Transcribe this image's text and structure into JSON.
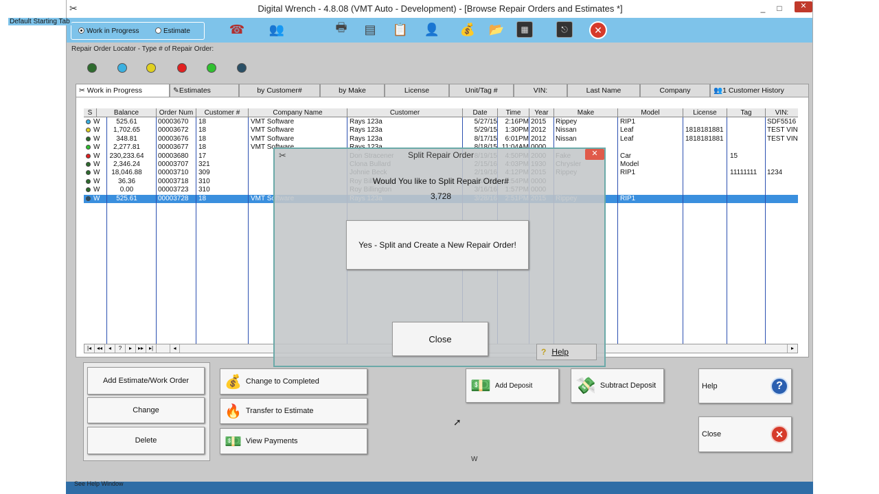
{
  "window": {
    "title": "Digital Wrench - 4.8.08 (VMT Auto - Development) - [Browse Repair Orders and Estimates *]",
    "minimize": "_",
    "maximize": "□",
    "close": "✕"
  },
  "toolbar": {
    "default_tab_legend": "Default Starting Tab",
    "radio_wip": "Work in Progress",
    "radio_estimate": "Estimate",
    "selected": "Work in Progress",
    "icons": [
      "phone-icon",
      "people-icon",
      "printer-icon",
      "report-icon",
      "document-icon",
      "technician-icon",
      "money-icon",
      "folder-icon",
      "monitor-icon",
      "logout-icon",
      "stop-icon"
    ]
  },
  "locator": {
    "label": "Repair Order Locator - Type # of Repair Order:",
    "status_colors": [
      "#2e6b2e",
      "#3ab0e0",
      "#e0d020",
      "#e02020",
      "#30c030",
      "#2a4f66"
    ]
  },
  "tabs": [
    "Work in Progress",
    "Estimates",
    "by Customer#",
    "by Make",
    "License",
    "Unit/Tag #",
    "VIN:",
    "Last Name",
    "Company",
    "1 Customer History"
  ],
  "grid": {
    "columns": [
      "S",
      "Balance",
      "Order Num",
      "Customer #",
      "Company Name",
      "Customer",
      "Date",
      "Time",
      "Year",
      "Make",
      "Model",
      "License",
      "Tag",
      "VIN:"
    ],
    "rows": [
      {
        "color": "#3ab0e0",
        "s": "W",
        "balance": "525.61",
        "order": "00003670",
        "cust": "18",
        "company": "VMT Software",
        "customer": "Rays 123a",
        "date": "5/27/15",
        "time": "2:16PM",
        "year": "2015",
        "make": "Rippey",
        "model": "RIP1",
        "license": "",
        "tag": "",
        "vin": "SDF5516"
      },
      {
        "color": "#e0d020",
        "s": "W",
        "balance": "1,702.65",
        "order": "00003672",
        "cust": "18",
        "company": "VMT Software",
        "customer": "Rays 123a",
        "date": "5/29/15",
        "time": "1:30PM",
        "year": "2012",
        "make": "Nissan",
        "model": "Leaf",
        "license": "1818181881",
        "tag": "",
        "vin": "TEST VIN"
      },
      {
        "color": "#2e6b2e",
        "s": "W",
        "balance": "348.81",
        "order": "00003676",
        "cust": "18",
        "company": "VMT Software",
        "customer": "Rays 123a",
        "date": "8/17/15",
        "time": "6:01PM",
        "year": "2012",
        "make": "Nissan",
        "model": "Leaf",
        "license": "1818181881",
        "tag": "",
        "vin": "TEST VIN"
      },
      {
        "color": "#30c030",
        "s": "W",
        "balance": "2,277.81",
        "order": "00003677",
        "cust": "18",
        "company": "VMT Software",
        "customer": "Rays 123a",
        "date": "8/18/15",
        "time": "11:04AM",
        "year": "0000",
        "make": "",
        "model": "",
        "license": "",
        "tag": "",
        "vin": ""
      },
      {
        "color": "#e02020",
        "s": "W",
        "balance": "230,233.64",
        "order": "00003680",
        "cust": "17",
        "company": "",
        "customer": "Don Stracener",
        "date": "8/19/15",
        "time": "4:50PM",
        "year": "2000",
        "make": "Fake",
        "model": "Car",
        "license": "",
        "tag": "15",
        "vin": ""
      },
      {
        "color": "#2e6b2e",
        "s": "W",
        "balance": "2,346.24",
        "order": "00003707",
        "cust": "321",
        "company": "",
        "customer": "Clona Bullard",
        "date": "2/15/16",
        "time": "4:03PM",
        "year": "1930",
        "make": "Chrysler",
        "model": "Model",
        "license": "",
        "tag": "",
        "vin": ""
      },
      {
        "color": "#2e6b2e",
        "s": "W",
        "balance": "18,046.88",
        "order": "00003710",
        "cust": "309",
        "company": "",
        "customer": "Johnie Beck",
        "date": "2/19/16",
        "time": "4:12PM",
        "year": "2015",
        "make": "Rippey",
        "model": "RIP1",
        "license": "",
        "tag": "11111111",
        "vin": "1234"
      },
      {
        "color": "#2e6b2e",
        "s": "W",
        "balance": "36.36",
        "order": "00003718",
        "cust": "310",
        "company": "",
        "customer": "Roy Billington",
        "date": "3/1/16",
        "time": "2:54PM",
        "year": "0000",
        "make": "",
        "model": "",
        "license": "",
        "tag": "",
        "vin": ""
      },
      {
        "color": "#2e6b2e",
        "s": "W",
        "balance": "0.00",
        "order": "00003723",
        "cust": "310",
        "company": "",
        "customer": "Roy Billington",
        "date": "3/16/16",
        "time": "1:57PM",
        "year": "0000",
        "make": "",
        "model": "",
        "license": "",
        "tag": "",
        "vin": ""
      },
      {
        "color": "#2a4f66",
        "s": "W",
        "balance": "525.61",
        "order": "00003728",
        "cust": "18",
        "company": "VMT Software",
        "customer": "Rays 123a",
        "date": "3/28/16",
        "time": "2:51PM",
        "year": "2015",
        "make": "Rippey",
        "model": "RIP1",
        "license": "",
        "tag": "",
        "vin": "",
        "selected": true
      }
    ],
    "nav": [
      "|◂",
      "◂◂",
      "◂",
      "?",
      "▸",
      "▸▸",
      "▸|"
    ]
  },
  "buttons": {
    "add": "Add Estimate/Work Order",
    "change": "Change",
    "delete": "Delete",
    "completed": "Change to Completed",
    "transfer": "Transfer to Estimate",
    "payments": "View Payments",
    "add_deposit": "Add Deposit",
    "subtract_deposit": "Subtract Deposit",
    "help": "Help",
    "close": "Close"
  },
  "dialog": {
    "title": "Split Repair Order",
    "question": "Would You like to Split Repair Order#",
    "number": "3,728",
    "yes": "Yes - Split and Create a New Repair Order!",
    "close": "Close",
    "help": "Help"
  },
  "status": {
    "text": "See Help Window",
    "stray": "W"
  }
}
